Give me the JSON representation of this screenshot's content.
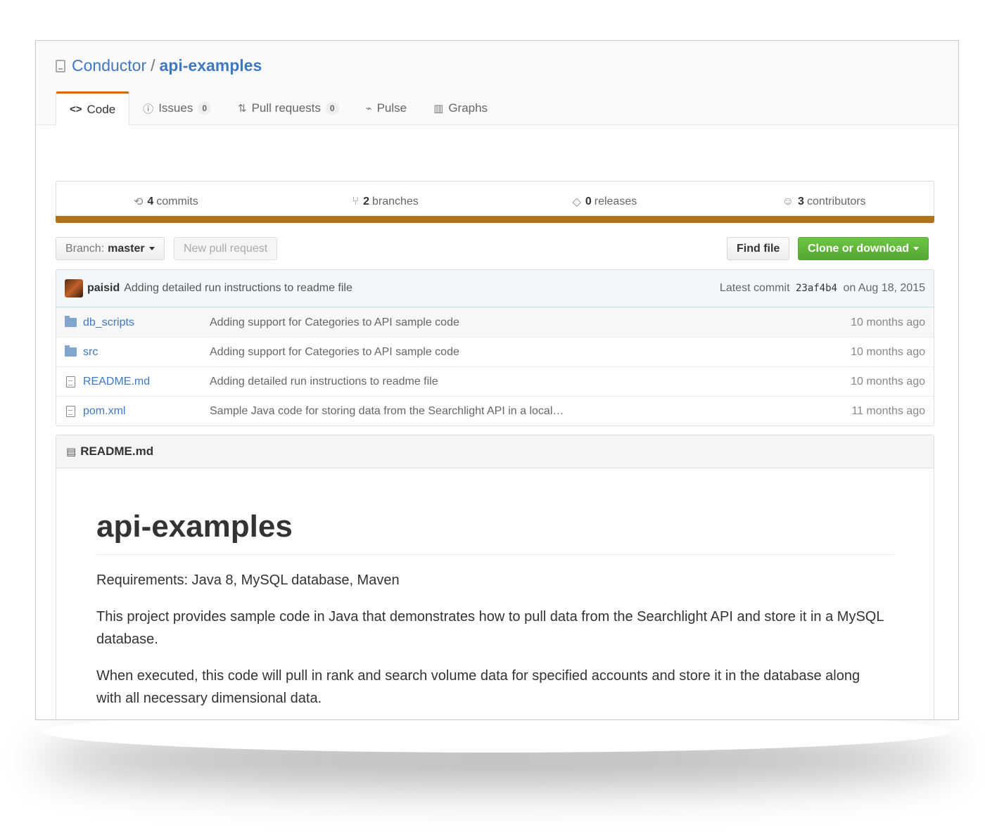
{
  "repo": {
    "owner": "Conductor",
    "separator": "/",
    "name": "api-examples"
  },
  "tabs": [
    {
      "label": "Code",
      "icon": "code-icon",
      "selected": true
    },
    {
      "label": "Issues",
      "icon": "issue-icon",
      "count": "0"
    },
    {
      "label": "Pull requests",
      "icon": "pull-request-icon",
      "count": "0"
    },
    {
      "label": "Pulse",
      "icon": "pulse-icon"
    },
    {
      "label": "Graphs",
      "icon": "graph-icon"
    }
  ],
  "summary": {
    "commits": {
      "count": "4",
      "label": "commits"
    },
    "branches": {
      "count": "2",
      "label": "branches"
    },
    "releases": {
      "count": "0",
      "label": "releases"
    },
    "contributors": {
      "count": "3",
      "label": "contributors"
    }
  },
  "language_bar_color": "#b07219",
  "toolbar": {
    "branch_prefix": "Branch:",
    "branch_name": "master",
    "new_pr": "New pull request",
    "find_file": "Find file",
    "clone": "Clone or download"
  },
  "latest_commit": {
    "author": "paisid",
    "message": "Adding detailed run instructions to readme file",
    "prefix": "Latest commit",
    "sha": "23af4b4",
    "date": "on Aug 18, 2015"
  },
  "files": [
    {
      "type": "folder",
      "name": "db_scripts",
      "message": "Adding support for Categories to API sample code",
      "age": "10 months ago"
    },
    {
      "type": "folder",
      "name": "src",
      "message": "Adding support for Categories to API sample code",
      "age": "10 months ago"
    },
    {
      "type": "file",
      "name": "README.md",
      "message": "Adding detailed run instructions to readme file",
      "age": "10 months ago"
    },
    {
      "type": "file",
      "name": "pom.xml",
      "message": "Sample Java code for storing data from the Searchlight API in a local…",
      "age": "11 months ago"
    }
  ],
  "readme": {
    "filename": "README.md",
    "title": "api-examples",
    "paragraphs": [
      "Requirements: Java 8, MySQL database, Maven",
      "This project provides sample code in Java that demonstrates how to pull data from the Searchlight API and store it in a MySQL database.",
      "When executed, this code will pull in rank and search volume data for specified accounts and store it in the database along with all necessary dimensional data."
    ]
  }
}
